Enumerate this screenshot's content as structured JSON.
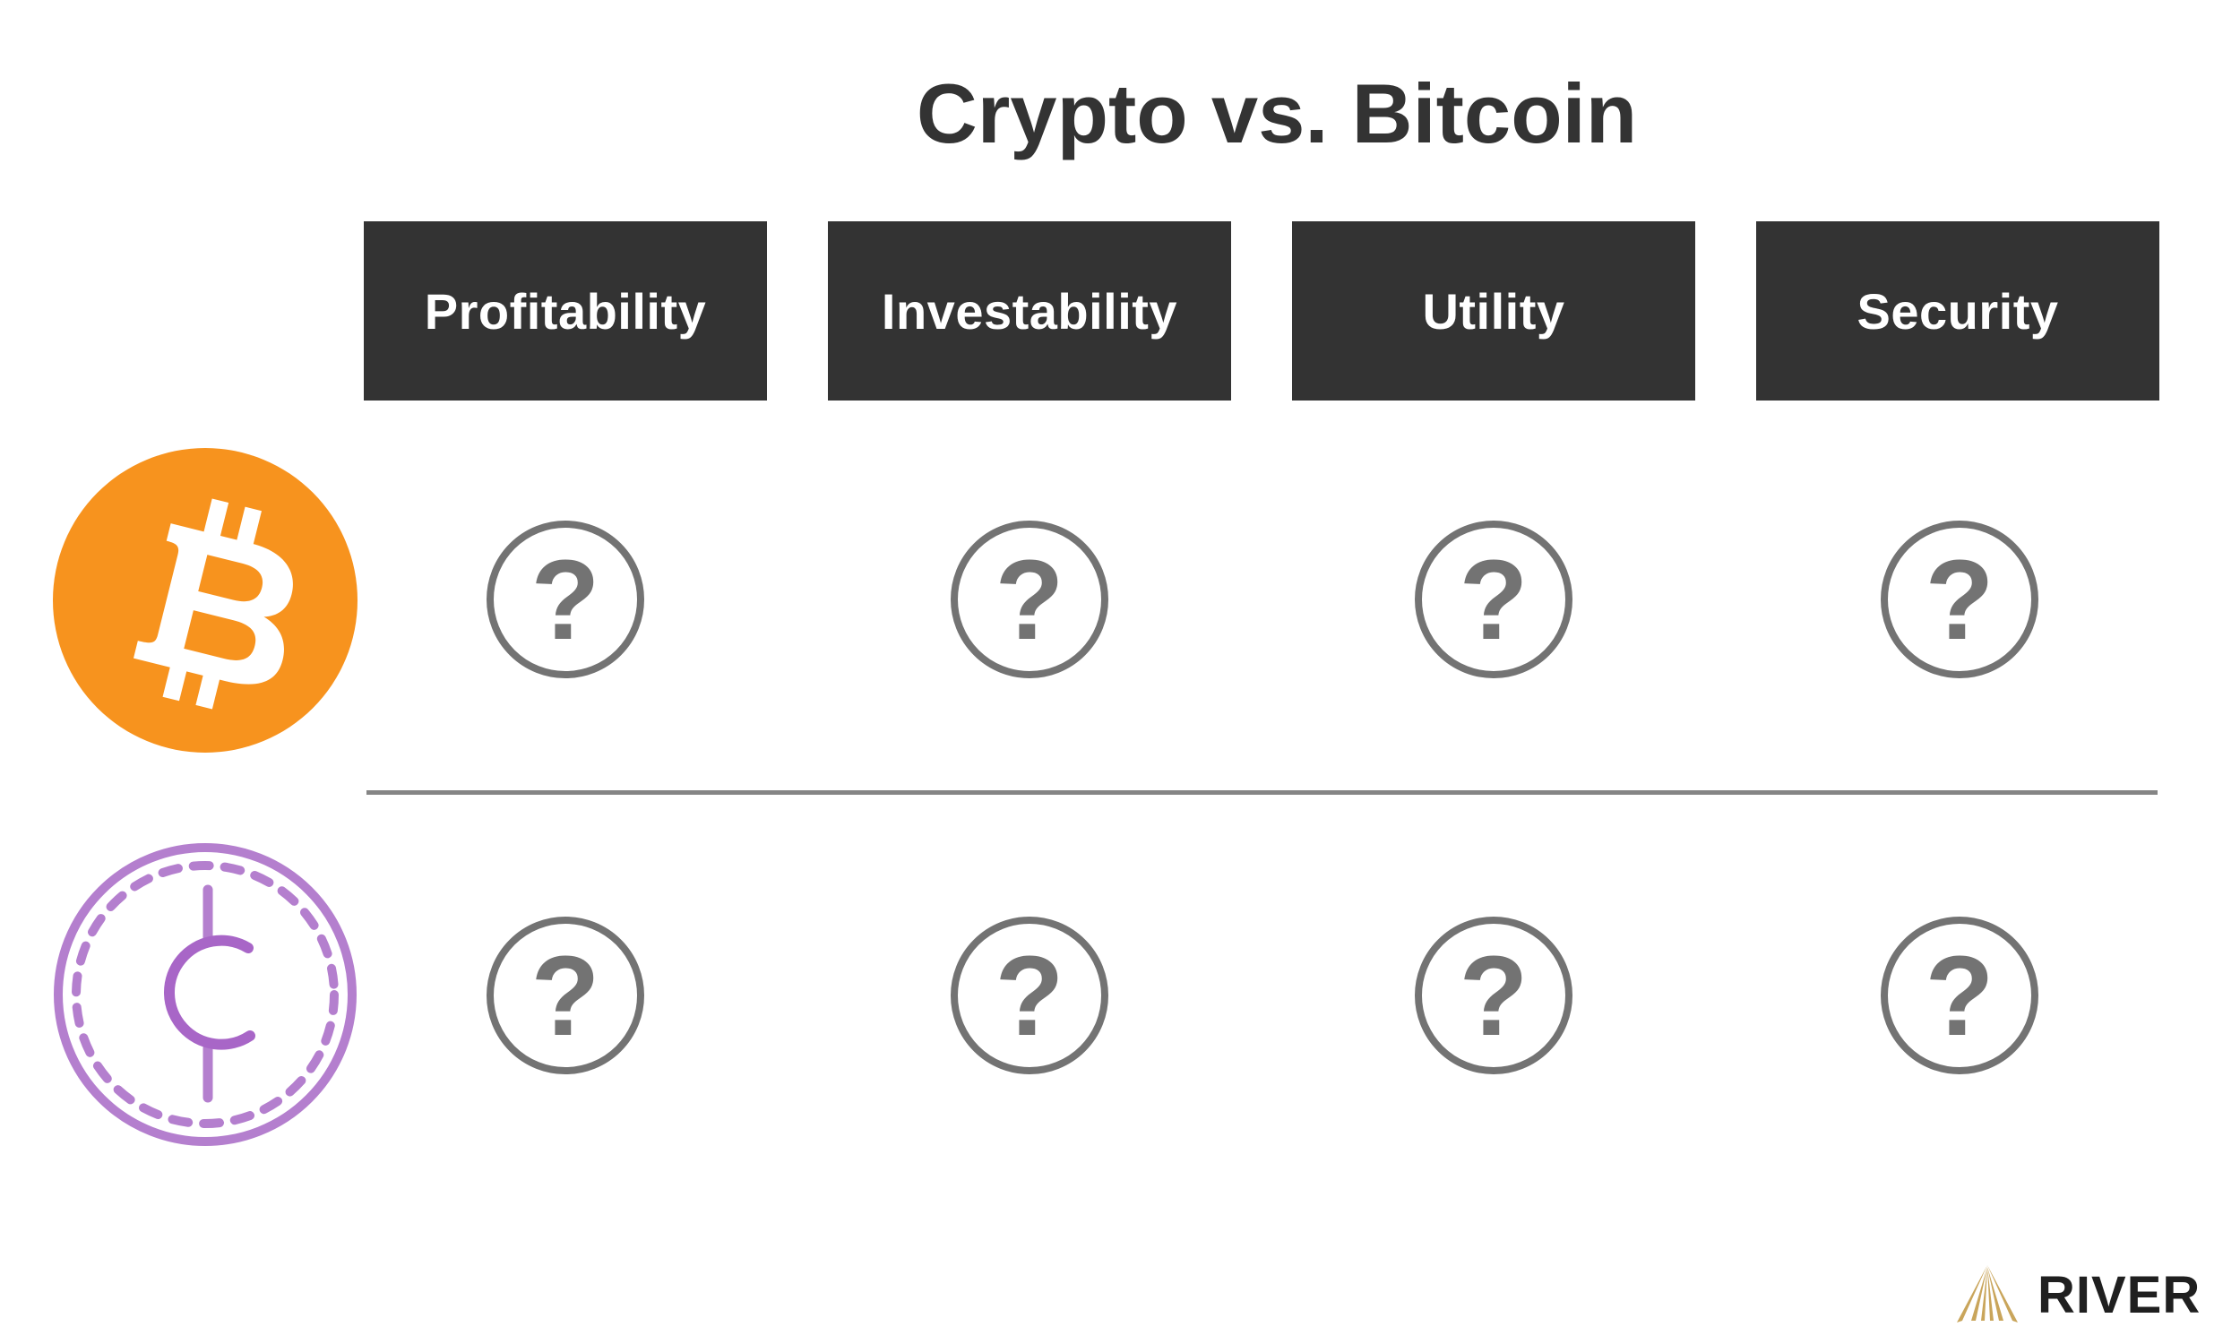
{
  "title": "Crypto vs. Bitcoin",
  "columns": [
    {
      "label": "Profitability"
    },
    {
      "label": "Investability"
    },
    {
      "label": "Utility"
    },
    {
      "label": "Security"
    }
  ],
  "rows": [
    {
      "name": "bitcoin",
      "icon": "bitcoin-icon",
      "color": "#f7931e",
      "cells": [
        "?",
        "?",
        "?",
        "?"
      ]
    },
    {
      "name": "crypto",
      "icon": "crypto-coin-icon",
      "color": "#b47fce",
      "cells": [
        "?",
        "?",
        "?",
        "?"
      ]
    }
  ],
  "colors": {
    "header_bg": "#333333",
    "header_text": "#ffffff",
    "title_text": "#333333",
    "question_icon": "#737373",
    "divider": "#858585",
    "brand_gold": "#c9a55b"
  },
  "brand": {
    "name": "RIVER"
  }
}
